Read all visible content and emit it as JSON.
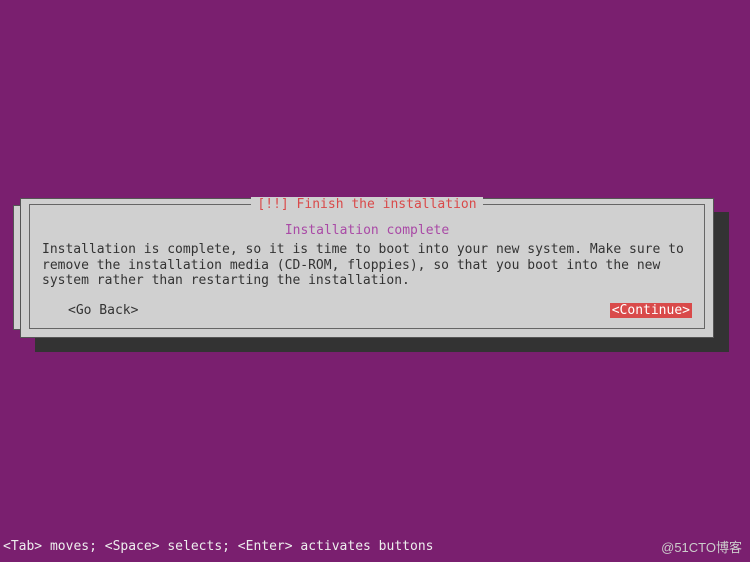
{
  "dialog": {
    "title": "[!!] Finish the installation",
    "subtitle": "Installation complete",
    "body": "Installation is complete, so it is time to boot into your new system. Make sure to remove the installation media (CD-ROM, floppies), so that you boot into the new system rather than restarting the installation.",
    "go_back_label": "<Go Back>",
    "continue_label": "<Continue>"
  },
  "footer": {
    "help_text": "<Tab> moves; <Space> selects; <Enter> activates buttons"
  },
  "watermark": {
    "text": "@51CTO博客"
  }
}
